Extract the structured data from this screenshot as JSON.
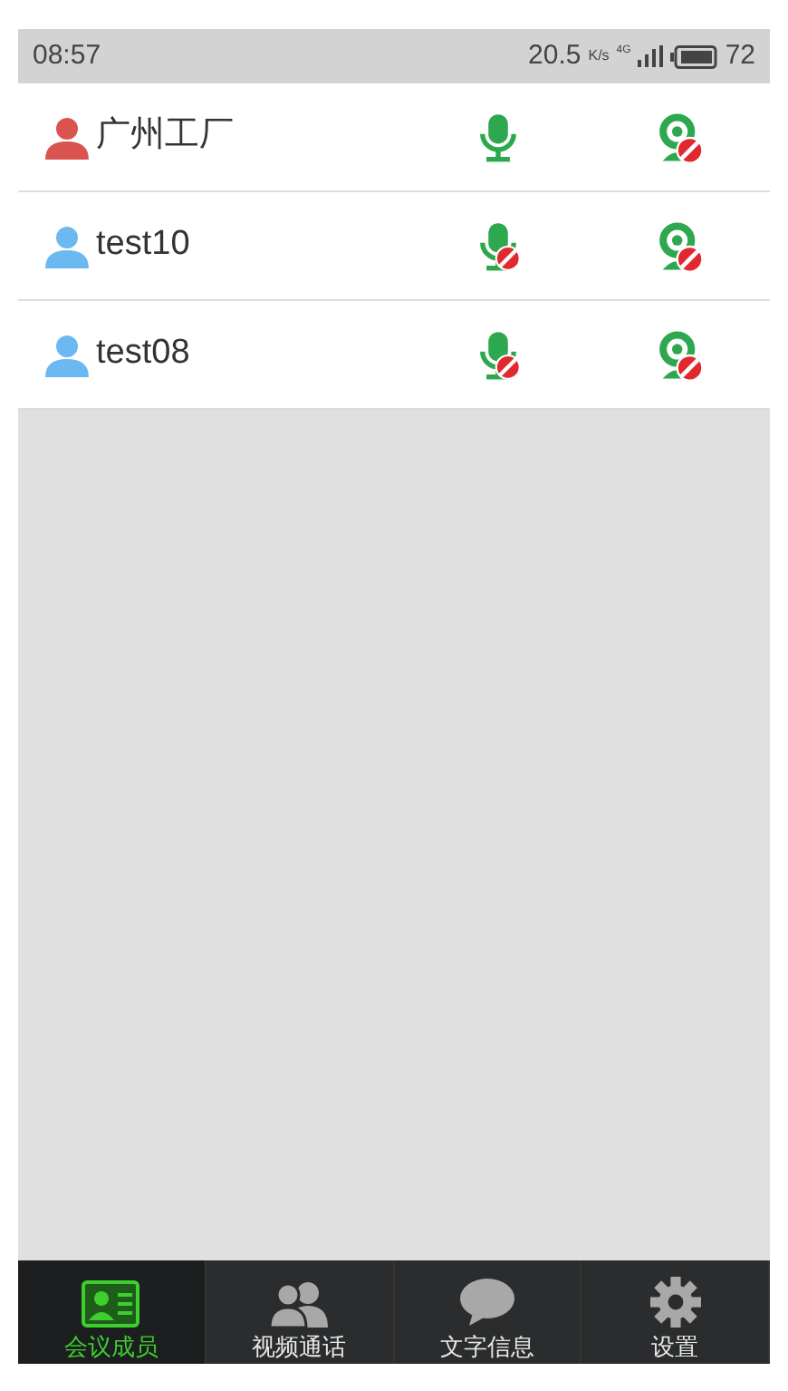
{
  "status_bar": {
    "time": "08:57",
    "speed": "20.5",
    "speed_unit": "K/s",
    "network": "4G",
    "battery": "72"
  },
  "members": [
    {
      "name": "广州工厂",
      "color": "#d9534f",
      "mic_muted": false,
      "camera_muted": true
    },
    {
      "name": "test10",
      "color": "#6cb8f0",
      "mic_muted": true,
      "camera_muted": true
    },
    {
      "name": "test08",
      "color": "#6cb8f0",
      "mic_muted": true,
      "camera_muted": true
    }
  ],
  "tabs": [
    {
      "label": "会议成员",
      "kind": "members",
      "selected": true
    },
    {
      "label": "视频通话",
      "kind": "video",
      "selected": false
    },
    {
      "label": "文字信息",
      "kind": "chat",
      "selected": false
    },
    {
      "label": "设置",
      "kind": "settings",
      "selected": false
    }
  ]
}
